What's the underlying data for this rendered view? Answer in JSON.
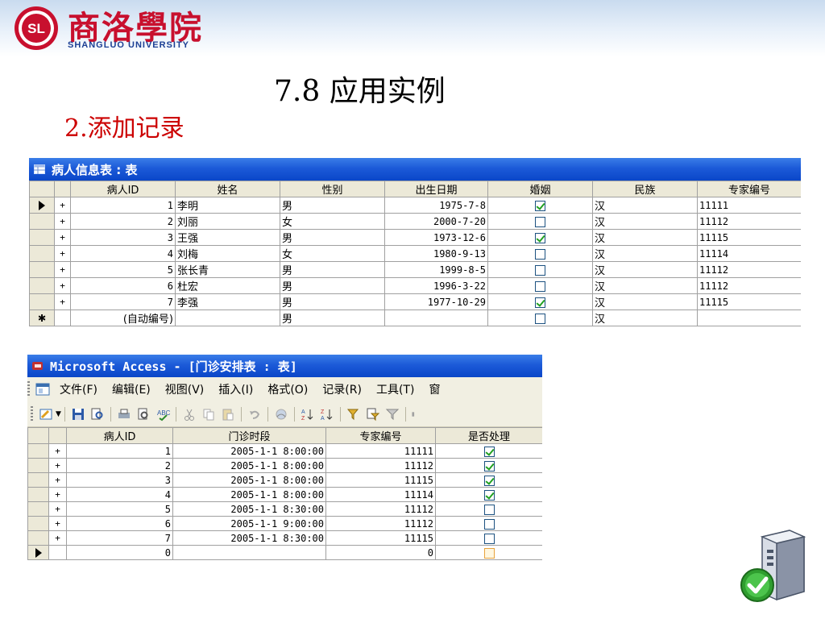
{
  "header": {
    "logo_cn": "商洛學院",
    "logo_en": "SHANGLUO UNIVERSITY",
    "seal_text": "SL"
  },
  "slide": {
    "title": "7.8 应用实例",
    "subtitle": "2.添加记录"
  },
  "patients_window": {
    "title": "病人信息表 : 表",
    "columns": [
      "病人ID",
      "姓名",
      "性别",
      "出生日期",
      "婚姻",
      "民族",
      "专家编号"
    ],
    "rows": [
      {
        "id": "1",
        "name": "李明",
        "sex": "男",
        "birth": "1975-7-8",
        "married": true,
        "nation": "汉",
        "expert": "11111"
      },
      {
        "id": "2",
        "name": "刘丽",
        "sex": "女",
        "birth": "2000-7-20",
        "married": false,
        "nation": "汉",
        "expert": "11112"
      },
      {
        "id": "3",
        "name": "王强",
        "sex": "男",
        "birth": "1973-12-6",
        "married": true,
        "nation": "汉",
        "expert": "11115"
      },
      {
        "id": "4",
        "name": "刘梅",
        "sex": "女",
        "birth": "1980-9-13",
        "married": false,
        "nation": "汉",
        "expert": "11114"
      },
      {
        "id": "5",
        "name": "张长青",
        "sex": "男",
        "birth": "1999-8-5",
        "married": false,
        "nation": "汉",
        "expert": "11112"
      },
      {
        "id": "6",
        "name": "杜宏",
        "sex": "男",
        "birth": "1996-3-22",
        "married": false,
        "nation": "汉",
        "expert": "11112"
      },
      {
        "id": "7",
        "name": "李强",
        "sex": "男",
        "birth": "1977-10-29",
        "married": true,
        "nation": "汉",
        "expert": "11115"
      }
    ],
    "new_row": {
      "id": "(自动编号)",
      "sex": "男",
      "nation": "汉"
    }
  },
  "access_window": {
    "title": "Microsoft Access - [门诊安排表 : 表]",
    "menu": [
      "文件(F)",
      "编辑(E)",
      "视图(V)",
      "插入(I)",
      "格式(O)",
      "记录(R)",
      "工具(T)",
      "窗"
    ],
    "columns": [
      "病人ID",
      "门诊时段",
      "专家编号",
      "是否处理"
    ],
    "rows": [
      {
        "id": "1",
        "time": "2005-1-1 8:00:00",
        "expert": "11111",
        "done": true
      },
      {
        "id": "2",
        "time": "2005-1-1 8:00:00",
        "expert": "11112",
        "done": true
      },
      {
        "id": "3",
        "time": "2005-1-1 8:00:00",
        "expert": "11115",
        "done": true
      },
      {
        "id": "4",
        "time": "2005-1-1 8:00:00",
        "expert": "11114",
        "done": true
      },
      {
        "id": "5",
        "time": "2005-1-1 8:30:00",
        "expert": "11112",
        "done": false
      },
      {
        "id": "6",
        "time": "2005-1-1 9:00:00",
        "expert": "11112",
        "done": false
      },
      {
        "id": "7",
        "time": "2005-1-1 8:30:00",
        "expert": "11115",
        "done": false
      }
    ],
    "new_row": {
      "id": "0",
      "expert": "0"
    }
  },
  "colors": {
    "title_red": "#cc0000",
    "logo_red": "#c8102e",
    "logo_blue": "#1c3f94",
    "xp_blue": "#0a46c8",
    "header_gray": "#ece9d8",
    "check_green": "#21a121"
  },
  "icons": {
    "server": "server-check-icon",
    "seal": "university-seal-icon"
  }
}
